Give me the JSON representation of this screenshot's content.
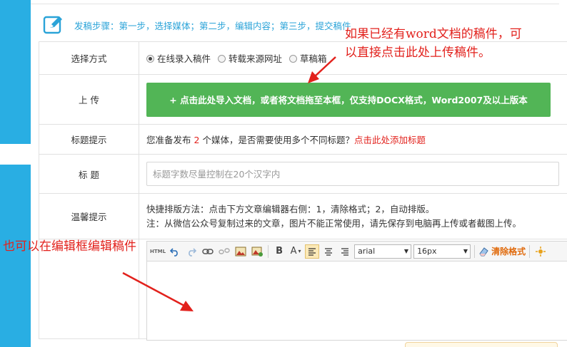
{
  "header": {
    "steps_text": "发稿步骤：第一步，选择媒体；第二步，编辑内容；第三步，提交稿件"
  },
  "form": {
    "method": {
      "label": "选择方式",
      "options": [
        "在线录入稿件",
        "转载来源网址",
        "草稿箱"
      ],
      "selected": "在线录入稿件"
    },
    "upload": {
      "label": "上 传",
      "button": "+ 点击此处导入文档，或者将文档拖至本框，仅支持DOCX格式，Word2007及以上版本"
    },
    "title_tip": {
      "label": "标题提示",
      "prefix": "您准备发布",
      "count": "2",
      "suffix": "个媒体，是否需要使用多个不同标题？",
      "link": "点击此处添加标题"
    },
    "title": {
      "label": "标 题",
      "placeholder": "标题字数尽量控制在20个汉字内"
    },
    "notice": {
      "label": "温馨提示",
      "line1": "快捷排版方法：点击下方文章编辑器右侧：1，清除格式；2，自动排版。",
      "line2": "注：从微信公众号复制过来的文章，图片不能正常使用，请先保存到电脑再上传或者截图上传。"
    }
  },
  "editor": {
    "toolbar": {
      "html_label": "HTML",
      "bold_label": "B",
      "font_color_label": "A",
      "font_family": "arial",
      "font_size": "16px",
      "clear_format": "清除格式"
    }
  },
  "annotations": {
    "top_line1": "如果已经有word文档的稿件，可",
    "top_line2": "以直接点击此处上传稿件。",
    "bottom": "也可以在编辑框编辑稿件"
  },
  "colors": {
    "sidebar_blue": "#29aee3",
    "upload_green": "#52b556",
    "annotation_red": "#e2211c"
  }
}
